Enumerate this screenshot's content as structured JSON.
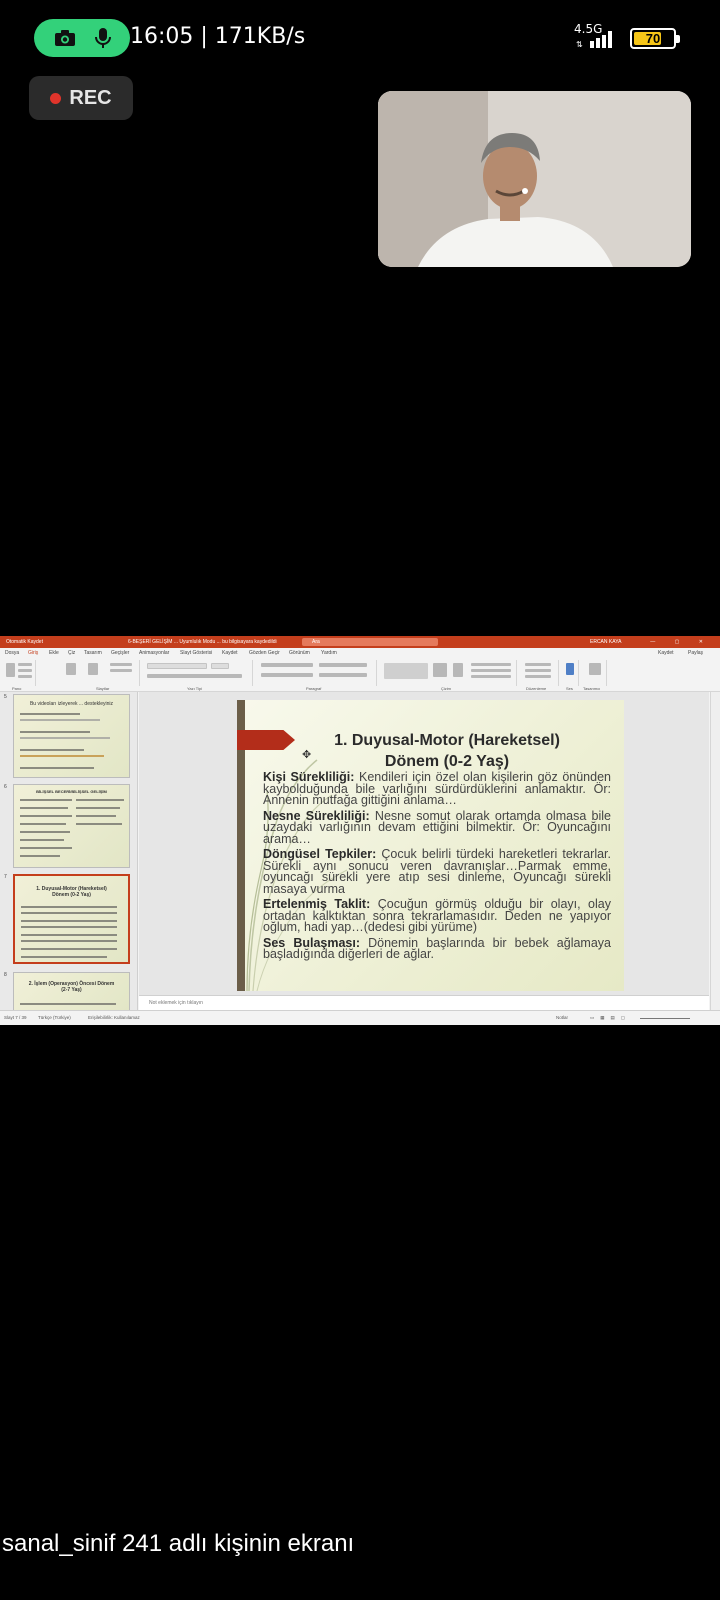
{
  "status_bar": {
    "time_speed": "16:05 | 171KB/s",
    "network": "4.5G",
    "battery": "70",
    "battery_level": 0.7
  },
  "recording": {
    "label": "REC"
  },
  "screen": {
    "titlebar": {
      "autosave": "Otomatik Kaydet",
      "document": "6-BEŞERİ GELİŞİM ... Uyumlulık Modu ... bu bilgisayara kaydedildi",
      "search": "Ara",
      "user": "ERCAN KAYA"
    },
    "menu": [
      "Dosya",
      "Giriş",
      "Ekle",
      "Çiz",
      "Tasarım",
      "Geçişler",
      "Animasyonlar",
      "Slayt Gösterisi",
      "Kaydet",
      "Gözden Geçir",
      "Görünüm",
      "Yardım"
    ],
    "menu_right": [
      "Kaydet",
      "Paylaş"
    ],
    "ribbon_groups": [
      "Pano",
      "Slaytlar",
      "Yazı Tipi",
      "Paragraf",
      "Çizim",
      "Düzenleme",
      "Ses",
      "Tasarımcı"
    ],
    "notes_placeholder": "Not eklemek için tıklayın",
    "statusbar": [
      "Slayt 7 / 39",
      "Türkçe (Türkiye)",
      "Erişilebilirlik: Kullanılamaz",
      "Notlar"
    ],
    "thumbnails": [
      {
        "number": "5",
        "title": "Bu videoları izleyerek ... destekleyiniz"
      },
      {
        "number": "6",
        "title": "BİLİŞSEL BECERİ/BİLİŞSEL GELİŞİM"
      },
      {
        "number": "7",
        "title": "1. Duyusal-Motor (Hareketsel) Dönem (0-2 Yaş)"
      },
      {
        "number": "8",
        "title": "2. İşlem (Operasyon) Öncesi Dönem (2-7 Yaş)"
      }
    ]
  },
  "slide": {
    "title_line1": "1. Duyusal-Motor (Hareketsel)",
    "title_line2": "Dönem (0-2 Yaş)",
    "items": [
      {
        "term": "Kişi Sürekliliği:",
        "text": " Kendileri için özel olan kişilerin göz önünden kaybolduğunda bile varlığını sürdürdüklerini anlamaktır. Ör: Annenin mutfağa gittiğini anlama…"
      },
      {
        "term": "Nesne Sürekliliği:",
        "text": " Nesne somut olarak ortamda olmasa bile uzaydaki varlığının devam ettiğini bilmektir. Ör: Oyuncağını arama…"
      },
      {
        "term": "Döngüsel Tepkiler:",
        "text": " Çocuk belirli türdeki hareketleri tekrarlar. Sürekli aynı sonucu veren davranışlar…Parmak emme, oyuncağı sürekli yere atıp sesi dinleme, Oyuncağı sürekli masaya vurma"
      },
      {
        "term": "Ertelenmiş Taklit:",
        "text": " Çocuğun görmüş olduğu bir olayı, olay ortadan kalktıktan sonra tekrarlamasıdır. Deden ne yapıyor oğlum, hadi yap…(dedesi gibi yürüme)"
      },
      {
        "term": "Ses Bulaşması:",
        "text": " Dönemin başlarında bir bebek ağlamaya başladığında diğerleri de ağlar."
      }
    ]
  },
  "caption": "sanal_sinif 241 adlı kişinin ekranı"
}
